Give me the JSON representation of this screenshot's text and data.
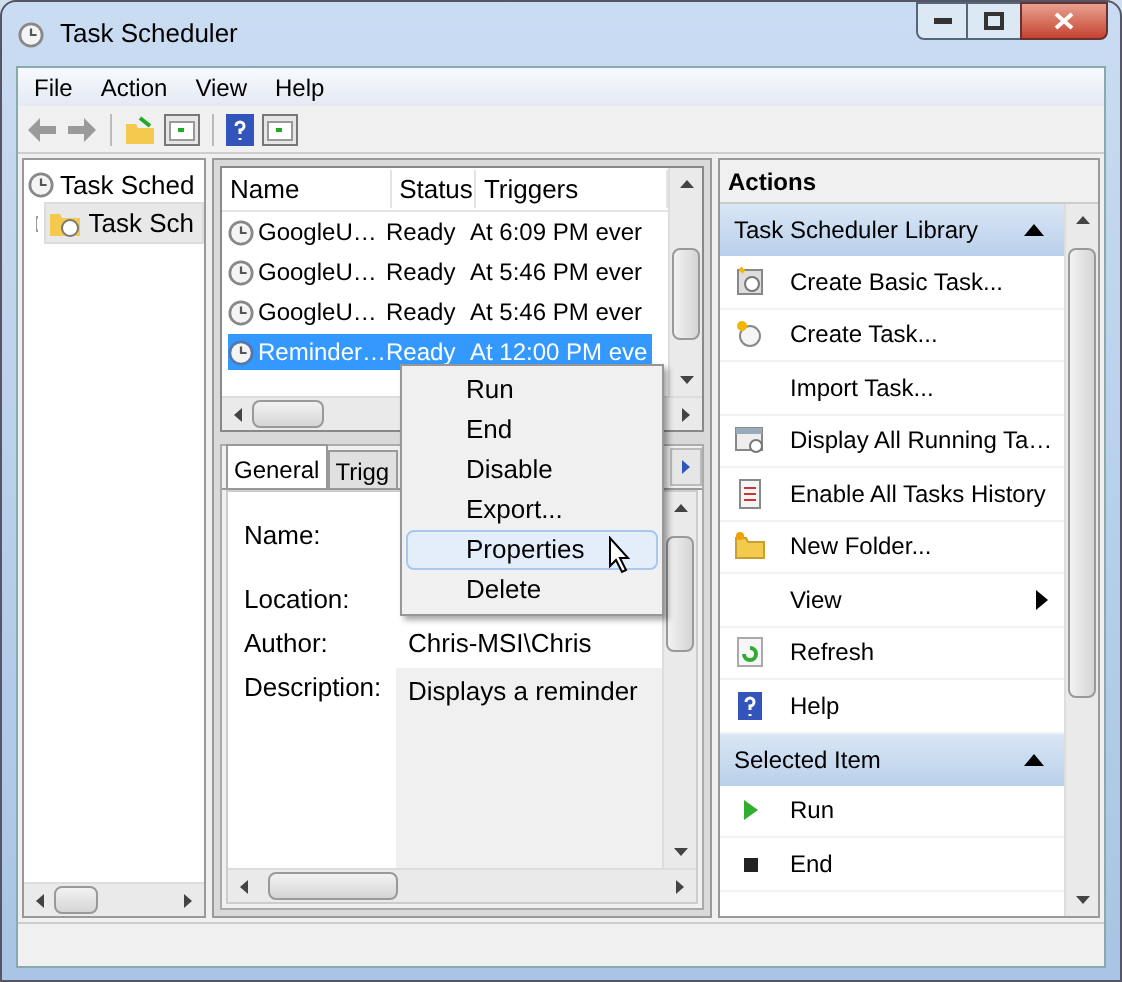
{
  "window": {
    "title": "Task Scheduler"
  },
  "menu": [
    "File",
    "Action",
    "View",
    "Help"
  ],
  "tree": [
    {
      "label": "Task Sched",
      "children": [
        {
          "label": "Task Sch",
          "selected": true
        }
      ]
    }
  ],
  "task_list": {
    "columns": [
      "Name",
      "Status",
      "Triggers"
    ],
    "rows": [
      {
        "name": "GoogleU…",
        "status": "Ready",
        "triggers": "At 6:09 PM ever",
        "selected": false
      },
      {
        "name": "GoogleU…",
        "status": "Ready",
        "triggers": "At 5:46 PM ever",
        "selected": false
      },
      {
        "name": "GoogleU…",
        "status": "Ready",
        "triggers": "At 5:46 PM ever",
        "selected": false
      },
      {
        "name": "Reminder…",
        "status": "Ready",
        "triggers": "At 12:00 PM eve",
        "selected": true
      }
    ]
  },
  "detail": {
    "tabs": [
      {
        "label": "General",
        "selected": true
      },
      {
        "label": "Trigg",
        "selected": false
      }
    ],
    "fields": [
      {
        "label": "Name:"
      },
      {
        "label": "Location:"
      },
      {
        "label": "Author:",
        "value": "Chris-MSI\\Chris"
      },
      {
        "label": "Description:",
        "value": "Displays a reminder"
      }
    ]
  },
  "context_menu": [
    {
      "label": "Run",
      "selected": false
    },
    {
      "label": "End",
      "selected": false
    },
    {
      "label": "Disable",
      "selected": false
    },
    {
      "label": "Export...",
      "selected": false
    },
    {
      "label": "Properties",
      "selected": true
    },
    {
      "label": "Delete",
      "selected": false
    }
  ],
  "actions": {
    "title": "Actions",
    "sections": [
      {
        "title": "Task Scheduler Library",
        "expanded": true,
        "items": [
          {
            "label": "Create Basic Task...",
            "kind": "wizard"
          },
          {
            "label": "Create Task...",
            "kind": "clock"
          },
          {
            "label": "Import Task...",
            "kind": "plain"
          },
          {
            "label": "Display All Running Ta…",
            "kind": "monitor"
          },
          {
            "label": "Enable All Tasks History",
            "kind": "log"
          },
          {
            "label": "New Folder...",
            "kind": "folder"
          },
          {
            "label": "View",
            "kind": "submenu"
          },
          {
            "label": "Refresh",
            "kind": "refresh"
          },
          {
            "label": "Help",
            "kind": "help"
          }
        ]
      },
      {
        "title": "Selected Item",
        "expanded": true,
        "items": [
          {
            "label": "Run",
            "kind": "play"
          },
          {
            "label": "End",
            "kind": "stop"
          }
        ]
      }
    ]
  }
}
